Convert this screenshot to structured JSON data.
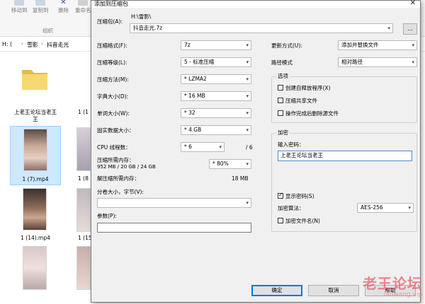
{
  "explorer": {
    "ribbon": {
      "move_to": "移动到",
      "copy_to": "复制到",
      "delete": "删除",
      "rename": "重命名",
      "group": "组织"
    },
    "address": [
      "H:",
      "雪影",
      "抖音走光"
    ],
    "files": [
      {
        "name": "上老王论坛当老王",
        "type": "folder"
      },
      {
        "name": "1 (1",
        "type": "video"
      },
      {
        "name": "1 (7).mp4",
        "type": "video"
      },
      {
        "name": "1 (8",
        "type": "video"
      },
      {
        "name": "1 (14).mp4",
        "type": "video"
      },
      {
        "name": "1 (15",
        "type": "video"
      }
    ]
  },
  "watermark": {
    "main": "老王论坛",
    "sub": "laowang.vip"
  },
  "dialog": {
    "title": "添加到压缩包",
    "archive_label": "压缩包(A):",
    "archive_path": "H:\\雪影\\",
    "archive_name": "抖音走光.7z",
    "browse_label": "...",
    "format_label": "压缩格式(F):",
    "format_value": "7z",
    "level_label": "压缩等级(L):",
    "level_value": "5 - 标准压缩",
    "method_label": "压缩方法(M):",
    "method_value": "* LZMA2",
    "dict_label": "字典大小(D):",
    "dict_value": "* 16 MB",
    "word_label": "单词大小(W):",
    "word_value": "* 32",
    "solid_label": "固实数据大小：",
    "solid_value": "* 4 GB",
    "cpu_label": "CPU 线程数：",
    "cpu_value": "* 6",
    "cpu_total": "/ 6",
    "mem_label": "压缩所需内存：",
    "mem_detail": "952 MB / 20 GB / 24 GB",
    "mem_value": "* 80%",
    "decomp_label": "解压缩所需内存：",
    "decomp_value": "18 MB",
    "split_label": "分卷大小，字节(V):",
    "params_label": "参数(P):",
    "update_label": "更新方式(U):",
    "update_value": "添加并替换文件",
    "path_label": "路径模式",
    "path_value": "相对路径",
    "options_title": "选项",
    "opt_sfx": "创建自释放程序(X)",
    "opt_shared": "压缩共享文件",
    "opt_delete": "操作完成后删除源文件",
    "encrypt_title": "加密",
    "pwd_label": "输入密码：",
    "pwd_value": "上老王论坛当老王",
    "show_pwd": "显示密码(S)",
    "enc_method_label": "加密算法：",
    "enc_method_value": "AES-256",
    "enc_names": "加密文件名(N)",
    "ok": "确定",
    "cancel": "取消",
    "help": "帮助"
  }
}
